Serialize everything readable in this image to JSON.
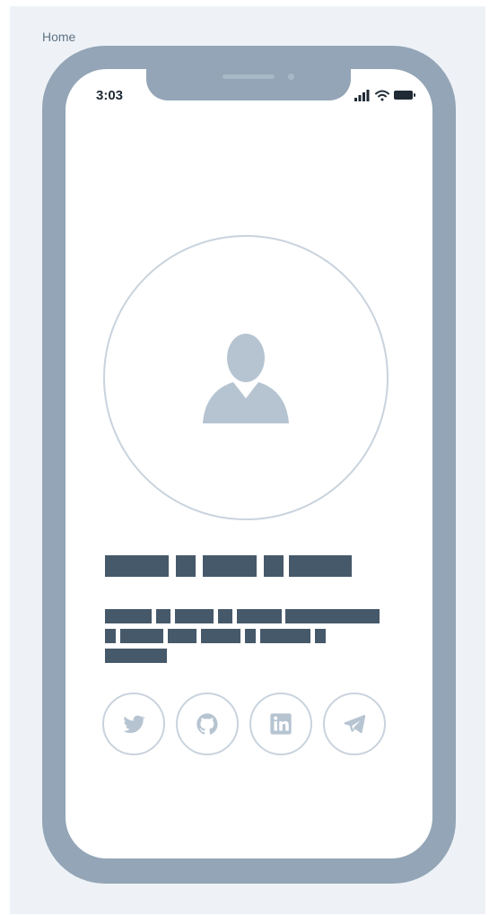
{
  "page": {
    "label": "Home"
  },
  "status_bar": {
    "time": "3:03",
    "icons": [
      "signal-icon",
      "wifi-icon",
      "battery-icon"
    ]
  },
  "profile": {
    "avatar_icon": "user-icon"
  },
  "social_links": [
    {
      "icon": "twitter-icon"
    },
    {
      "icon": "github-icon"
    },
    {
      "icon": "linkedin-icon"
    },
    {
      "icon": "telegram-icon"
    }
  ],
  "colors": {
    "background": "#eef2f6",
    "phone_frame": "#93a5b6",
    "screen": "#ffffff",
    "placeholder_text": "#46596a",
    "icon_gray": "#b6c4d1",
    "outline": "#c9d3dd"
  }
}
